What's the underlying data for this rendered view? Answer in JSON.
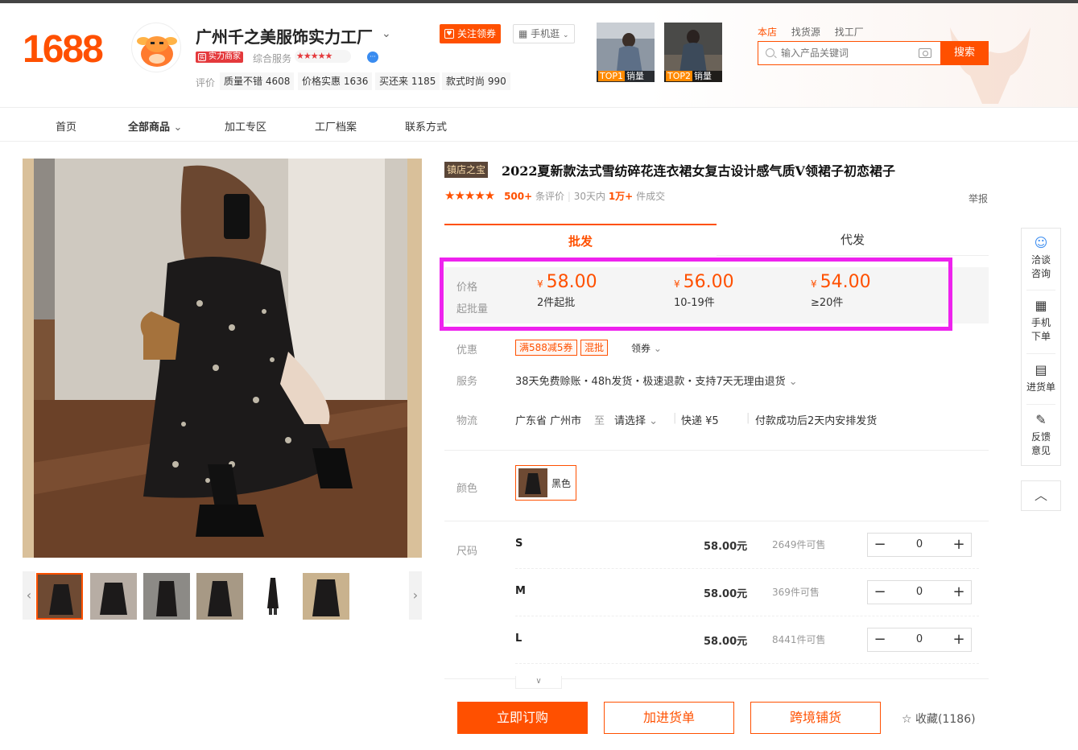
{
  "header": {
    "logo": "1688",
    "shop_name": "广州千之美服饰实力工厂",
    "power_badge": "实力商家",
    "service_label": "综合服务",
    "service_stars": "★★★★★",
    "eval_label": "评价",
    "eval_chips": [
      {
        "label": "质量不错 4608"
      },
      {
        "label": "价格实惠 1636"
      },
      {
        "label": "买还来 1185"
      },
      {
        "label": "款式时尚 990"
      }
    ],
    "follow_button": "关注领券",
    "mobile_button": "手机逛",
    "top_cards": [
      {
        "rank": "TOP1",
        "label": "销量"
      },
      {
        "rank": "TOP2",
        "label": "销量"
      }
    ],
    "search_scopes": [
      "本店",
      "找货源",
      "找工厂"
    ],
    "search_placeholder": "输入产品关键词",
    "search_button": "搜索"
  },
  "nav": {
    "items": [
      "首页",
      "全部商品",
      "加工专区",
      "工厂档案",
      "联系方式"
    ]
  },
  "product": {
    "title_tag": "镇店之宝",
    "title": "2022夏新款法式雪纺碎花连衣裙女复古设计感气质V领裙子初恋裙子",
    "stars": "★★★★★",
    "review_count": "500+",
    "review_suffix": "条评价",
    "sold_prefix": "30天内",
    "sold_count": "1万+",
    "sold_suffix": "件成交",
    "report": "举报",
    "tabs": [
      "批发",
      "代发"
    ],
    "price_label": "价格",
    "moq_label": "起批量",
    "currency": "¥",
    "price_tiers": [
      {
        "price": "58.00",
        "qty": "2件起批"
      },
      {
        "price": "56.00",
        "qty": "10-19件"
      },
      {
        "price": "54.00",
        "qty": "≥20件"
      }
    ],
    "promo_label": "优惠",
    "coupons": [
      "满588减5券",
      "混批"
    ],
    "claim": "领券",
    "service_label": "服务",
    "services": "38天免费赊账・48h发货・极速退款・支持7天无理由退货",
    "logistics_label": "物流",
    "logistics_from": "广东省 广州市",
    "logistics_to_word": "至",
    "logistics_select": "请选择",
    "express": "快递  ¥5",
    "delivery_note": "付款成功后2天内安排发货",
    "color_label": "颜色",
    "color_option": "黑色",
    "size_label": "尺码",
    "sizes": [
      {
        "size": "S",
        "price": "58.00元",
        "stock": "2649件可售",
        "qty": "0"
      },
      {
        "size": "M",
        "price": "58.00元",
        "stock": "369件可售",
        "qty": "0"
      },
      {
        "size": "L",
        "price": "58.00元",
        "stock": "8441件可售",
        "qty": "0"
      }
    ],
    "buy_button": "立即订购",
    "cart_button": "加进货单",
    "dist_button": "跨境铺货",
    "favorite": "收藏(1186)"
  },
  "sidebar": {
    "items": [
      {
        "l1": "洽谈",
        "l2": "咨询"
      },
      {
        "l1": "手机",
        "l2": "下单"
      },
      {
        "l1": "进货单",
        "l2": ""
      },
      {
        "l1": "反馈",
        "l2": "意见"
      }
    ]
  },
  "colors": {
    "accent": "#ff5000",
    "highlight_outline": "#ee22ee"
  }
}
